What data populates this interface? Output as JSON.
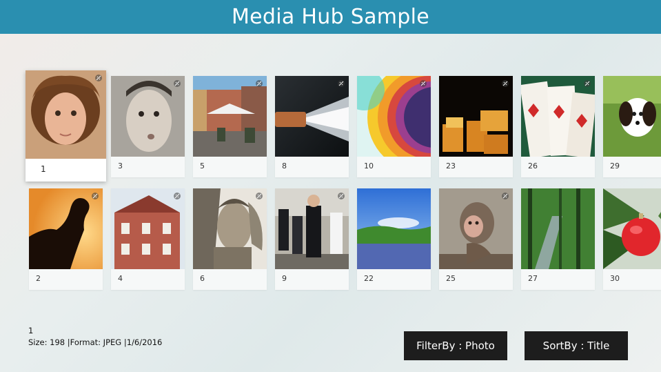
{
  "header": {
    "title": "Media Hub Sample"
  },
  "accent_color": "#2a8fb0",
  "tiles": [
    {
      "label": "1"
    },
    {
      "label": "3"
    },
    {
      "label": "5"
    },
    {
      "label": "8"
    },
    {
      "label": "10"
    },
    {
      "label": "23"
    },
    {
      "label": "26"
    },
    {
      "label": "29"
    },
    {
      "label": "2"
    },
    {
      "label": "4"
    },
    {
      "label": "6"
    },
    {
      "label": "9"
    },
    {
      "label": "22"
    },
    {
      "label": "25"
    },
    {
      "label": "27"
    },
    {
      "label": "30"
    }
  ],
  "details": {
    "title": "1",
    "meta": "Size: 198  |Format: JPEG  |1/6/2016"
  },
  "buttons": {
    "filter_label": "FilterBy : Photo",
    "sort_label": "SortBy : Title"
  }
}
